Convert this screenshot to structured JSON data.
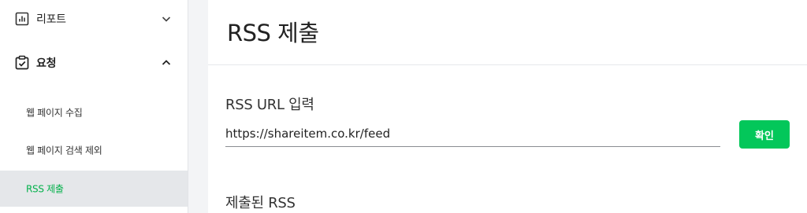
{
  "sidebar": {
    "report": {
      "label": "리포트",
      "icon": "bar-chart-icon",
      "chevron": "chevron-down-icon"
    },
    "request": {
      "label": "요청",
      "icon": "clipboard-check-icon",
      "chevron": "chevron-up-icon"
    },
    "sub_items": [
      {
        "label": "웹 페이지 수집",
        "active": false
      },
      {
        "label": "웹 페이지 검색 제외",
        "active": false
      },
      {
        "label": "RSS 제출",
        "active": true
      }
    ]
  },
  "main": {
    "title": "RSS 제출",
    "url_section_label": "RSS URL 입력",
    "url_input_value": "https://shareitem.co.kr/feed",
    "confirm_button_label": "확인",
    "submitted_section_label": "제출된 RSS"
  },
  "colors": {
    "accent": "#03c75a",
    "active_text": "#03b14b",
    "active_bg": "#e5e7ea"
  }
}
